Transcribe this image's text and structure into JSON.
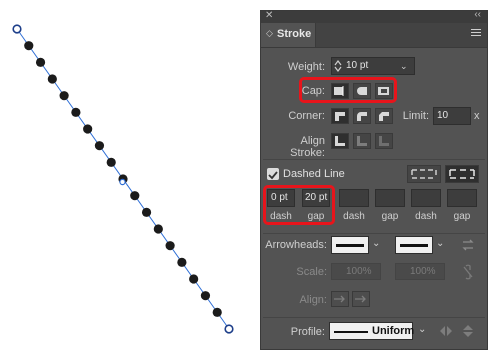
{
  "panel": {
    "title": "Stroke",
    "weight": {
      "label": "Weight:",
      "value": "10 pt"
    },
    "cap": {
      "label": "Cap:"
    },
    "corner": {
      "label": "Corner:",
      "limit_label": "Limit:",
      "limit_value": "10",
      "limit_unit": "x"
    },
    "align_stroke": {
      "label": "Align Stroke:"
    },
    "dashed_line": {
      "label": "Dashed Line",
      "checked": true
    },
    "dashes": [
      {
        "value": "0 pt",
        "label": "dash"
      },
      {
        "value": "20 pt",
        "label": "gap"
      },
      {
        "value": "",
        "label": "dash"
      },
      {
        "value": "",
        "label": "gap"
      },
      {
        "value": "",
        "label": "dash"
      },
      {
        "value": "",
        "label": "gap"
      }
    ],
    "arrowheads": {
      "label": "Arrowheads:"
    },
    "scale": {
      "label": "Scale:",
      "start": "100%",
      "end": "100%"
    },
    "align": {
      "label": "Align:"
    },
    "profile": {
      "label": "Profile:",
      "value": "Uniform"
    }
  },
  "colors": {
    "highlight": "#e8141b",
    "panel_bg": "#535353",
    "path_stroke": "#2f6fd6",
    "dot": "#1b1b1b"
  },
  "icons": [
    "close-icon",
    "collapse-icon",
    "panel-menu-icon",
    "stepper-icon",
    "chevron-down-icon",
    "swap-arrows-icon",
    "link-icon",
    "flip-icon"
  ]
}
